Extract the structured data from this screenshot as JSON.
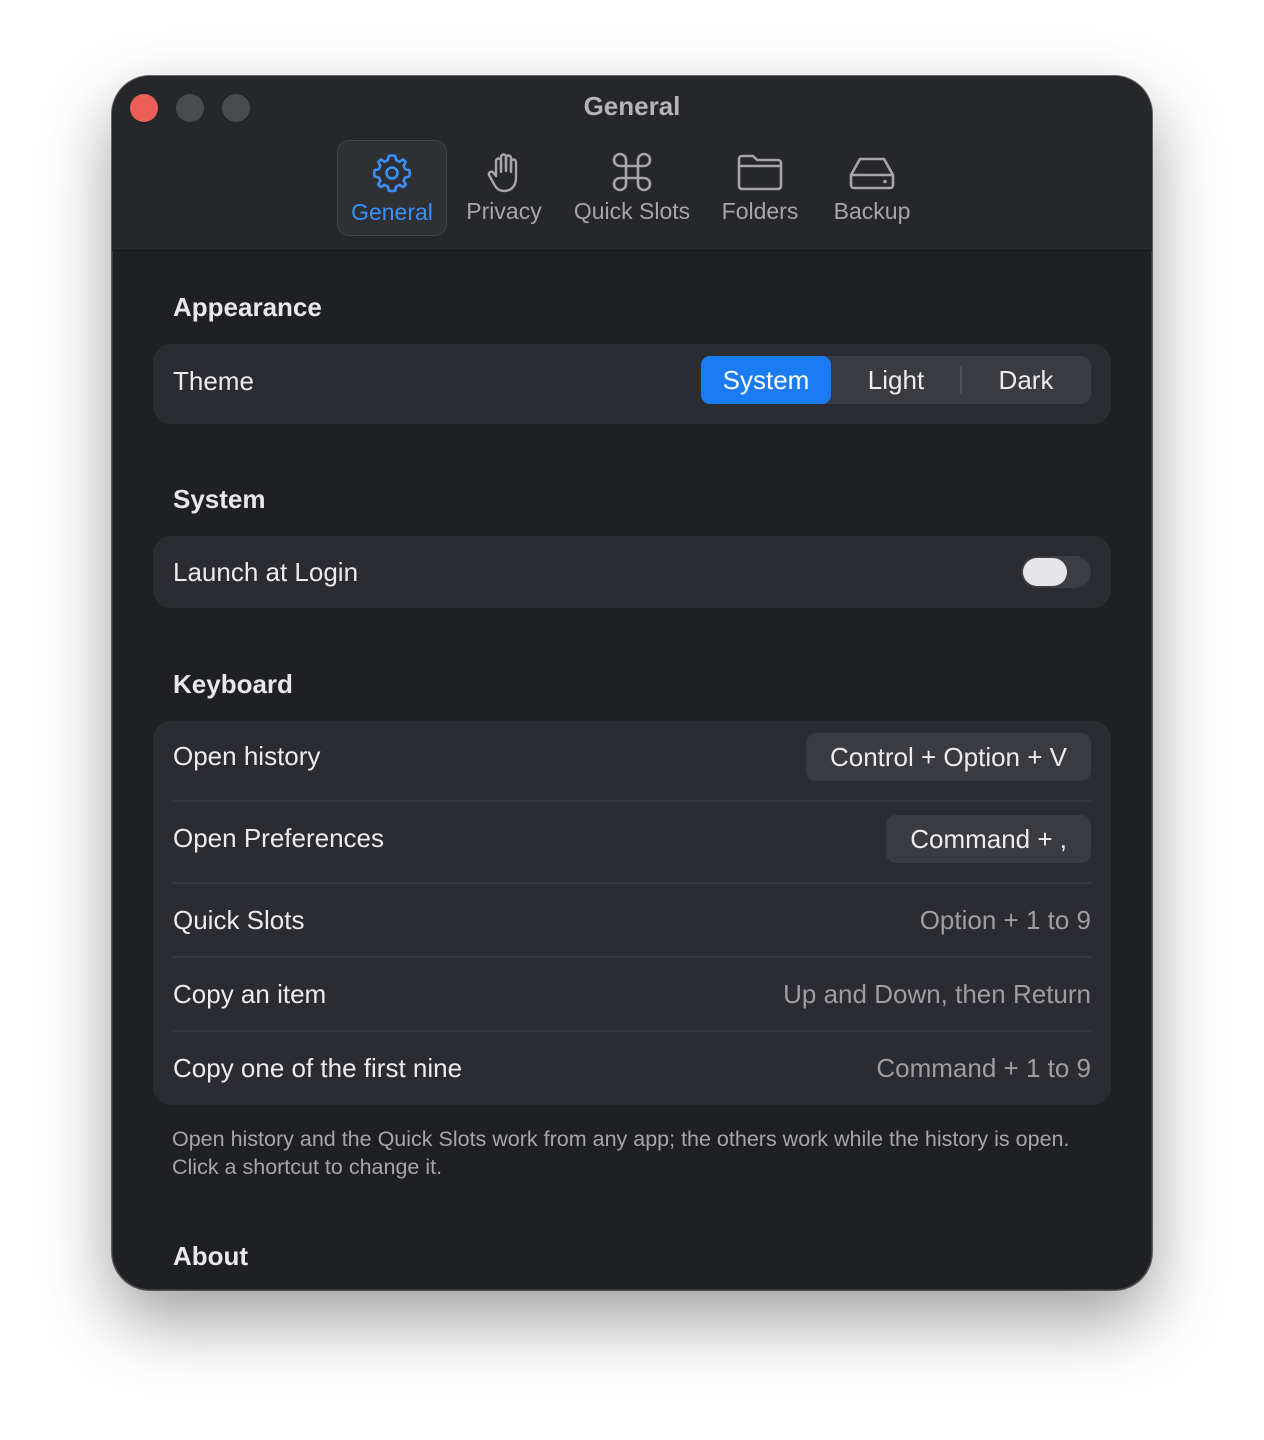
{
  "window": {
    "title": "General"
  },
  "toolbar": {
    "tabs": [
      {
        "label": "General",
        "icon": "gear-icon",
        "active": true
      },
      {
        "label": "Privacy",
        "icon": "hand-icon",
        "active": false
      },
      {
        "label": "Quick Slots",
        "icon": "command-icon",
        "active": false
      },
      {
        "label": "Folders",
        "icon": "folder-icon",
        "active": false
      },
      {
        "label": "Backup",
        "icon": "drive-icon",
        "active": false
      }
    ]
  },
  "appearance": {
    "title": "Appearance",
    "theme": {
      "label": "Theme",
      "options": [
        "System",
        "Light",
        "Dark"
      ],
      "selected": "System"
    }
  },
  "system": {
    "title": "System",
    "launch_at_login": {
      "label": "Launch at Login",
      "on": false
    }
  },
  "keyboard": {
    "title": "Keyboard",
    "rows": [
      {
        "label": "Open history",
        "shortcut": "Control + Option + V",
        "editable": true
      },
      {
        "label": "Open Preferences",
        "shortcut": "Command + ,",
        "editable": true
      },
      {
        "label": "Quick Slots",
        "shortcut": "Option + 1 to 9",
        "editable": false
      },
      {
        "label": "Copy an item",
        "shortcut": "Up and Down, then Return",
        "editable": false
      },
      {
        "label": "Copy one of the first nine",
        "shortcut": "Command + 1 to 9",
        "editable": false
      }
    ],
    "footnote": "Open history and the Quick Slots work from any app; the others work while the history is open. Click a shortcut to change it."
  },
  "about": {
    "title": "About"
  },
  "colors": {
    "accent": "#1a7bf2",
    "tab_active": "#3c8ff7",
    "close": "#ec5f56",
    "window_bg": "#1f2024",
    "card_bg": "#2b2c31"
  }
}
